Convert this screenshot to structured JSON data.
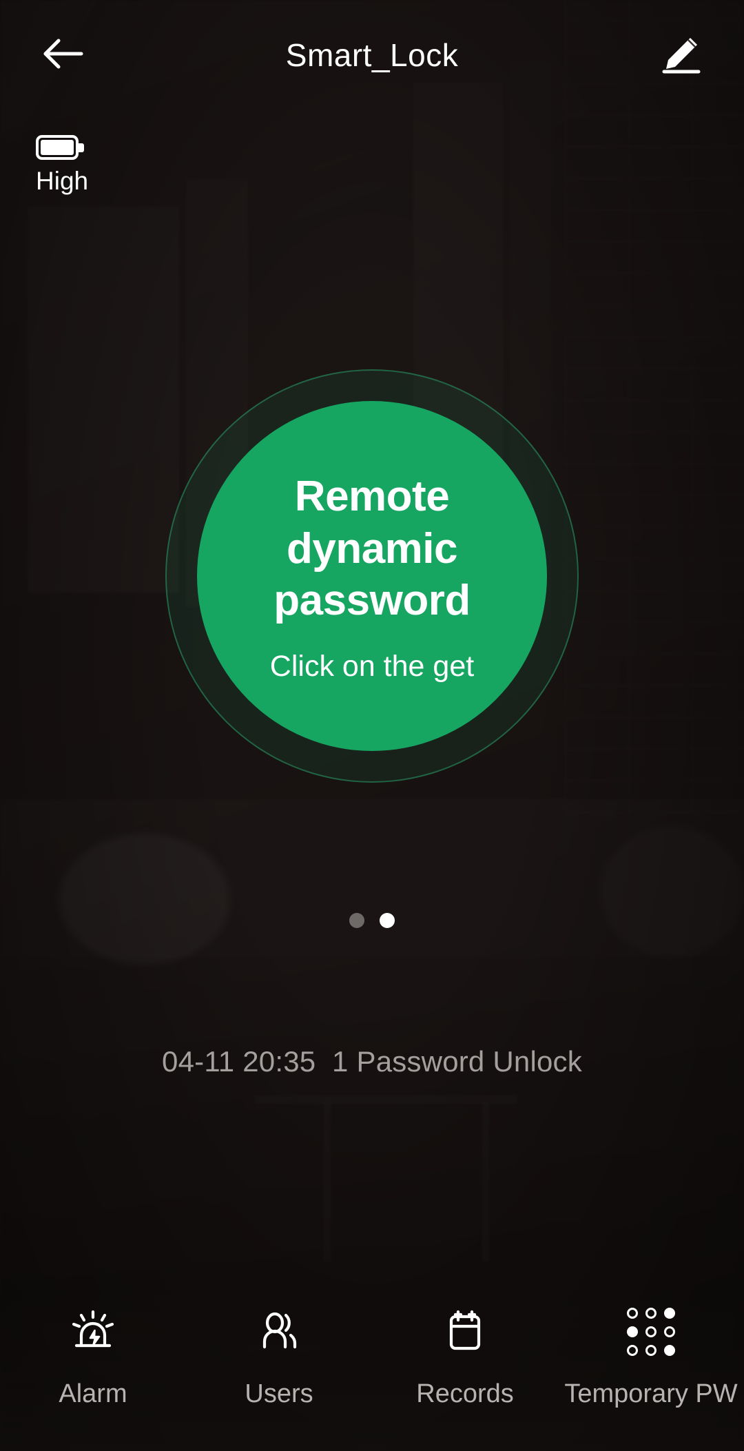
{
  "header": {
    "title": "Smart_Lock",
    "back_icon": "arrow-left-icon",
    "edit_icon": "pencil-edit-icon"
  },
  "battery": {
    "icon": "battery-full-icon",
    "level_label": "High"
  },
  "dial": {
    "title": "Remote dynamic password",
    "subtitle": "Click on the get",
    "accent_color": "#17a662",
    "ring_color": "#2ebe7d"
  },
  "pager": {
    "total": 2,
    "active_index": 1
  },
  "record": {
    "text": "04-11 20:35  1 Password Unlock",
    "date": "04-11",
    "time": "20:35",
    "event": "1 Password Unlock"
  },
  "bottom_nav": {
    "items": [
      {
        "label": "Alarm",
        "icon": "alarm-siren-icon"
      },
      {
        "label": "Users",
        "icon": "users-icon"
      },
      {
        "label": "Records",
        "icon": "calendar-records-icon"
      },
      {
        "label": "Temporary PW",
        "icon": "keypad-dots-icon"
      }
    ]
  }
}
